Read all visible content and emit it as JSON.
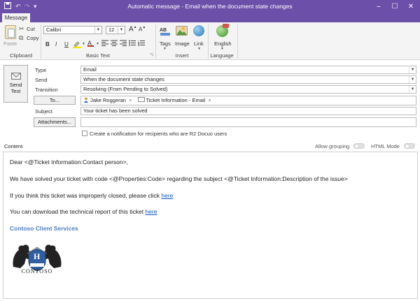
{
  "window": {
    "title": "Automatic message - Email when the document state changes"
  },
  "ribbon": {
    "tab_message": "Message",
    "clipboard": {
      "paste": "Paste",
      "cut": "Cut",
      "copy": "Copy",
      "group": "Clipboard"
    },
    "basic_text": {
      "font": "Calibri",
      "size": "12",
      "bold": "B",
      "italic": "I",
      "underline": "U",
      "group": "Basic Text"
    },
    "insert": {
      "tags": "Tags",
      "image": "Image",
      "link": "Link",
      "group": "Insert"
    },
    "language": {
      "english": "English",
      "group": "Language"
    }
  },
  "form": {
    "send_button": "Send Test",
    "type_label": "Type",
    "type_value": "Email",
    "send_label": "Send",
    "send_value": "When the document state changes",
    "transition_label": "Transition",
    "transition_value": "Resolving (From Pending to Solved)",
    "to_button": "To...",
    "recipients": [
      "Jake Roggeran",
      "Ticket Information - Email"
    ],
    "subject_label": "Subject",
    "subject_value": "Your ticket has been solved",
    "attachments_button": "Attachments...",
    "notification_label": "Create a notification for recipients who are R2 Docuo users"
  },
  "content": {
    "label": "Content",
    "allow_grouping": "Allow grouping",
    "html_mode": "HTML Mode",
    "line1": "Dear <@Ticket Information:Contact person>,",
    "line2": "We have solved your ticket with code <@Properties:Code> regarding the subject <@Ticket Information:Description of the issue>",
    "line3_prefix": "If you think this ticket was improperly closed, please click ",
    "line3_link": "here",
    "line4_prefix": "You can download the technical report of this ticket ",
    "line4_link": "here",
    "signature": "Contoso Client Services",
    "logo_letter": "H",
    "logo_text": "CONTOSO"
  },
  "colors": {
    "title_bar": "#6b4fa8",
    "link": "#1155cc",
    "signature": "#4a7ec4"
  }
}
